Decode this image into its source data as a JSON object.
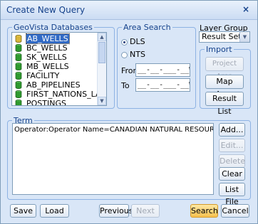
{
  "window": {
    "title": "Create New Query",
    "close_label": "×"
  },
  "databases": {
    "legend": "GeoVista Databases",
    "items": [
      {
        "label": "AB_WELLS",
        "selected": true
      },
      {
        "label": "BC_WELLS",
        "selected": false
      },
      {
        "label": "SK_WELLS",
        "selected": false
      },
      {
        "label": "MB_WELLS",
        "selected": false
      },
      {
        "label": "FACILITY",
        "selected": false
      },
      {
        "label": "AB_PIPELINES",
        "selected": false
      },
      {
        "label": "FIRST_NATIONS_LAND",
        "selected": false
      },
      {
        "label": "POSTINGS",
        "selected": false
      }
    ]
  },
  "area_search": {
    "legend": "Area Search",
    "options": [
      {
        "label": "DLS",
        "checked": true
      },
      {
        "label": "NTS",
        "checked": false
      }
    ],
    "from_label": "From",
    "from_value": "__-__-___-__W_",
    "to_label": "To",
    "to_value": "__-__-___-__W_"
  },
  "layer_group": {
    "label": "Layer Group",
    "selected": "Result Sets"
  },
  "import": {
    "legend": "Import",
    "buttons": {
      "project_area": "Project Area",
      "map_area": "Map Area",
      "result_list": "Result List"
    }
  },
  "term": {
    "legend": "Term",
    "entries": [
      "Operator:Operator Name=CANADIAN NATURAL RESOURCES LIMITED"
    ],
    "buttons": {
      "add": "Add...",
      "edit": "Edit...",
      "delete": "Delete",
      "clear_all": "Clear All",
      "list_file": "List File"
    }
  },
  "footer": {
    "save": "Save",
    "load": "Load",
    "previous": "Previous",
    "next": "Next",
    "search": "Search",
    "cancel": "Cancel"
  },
  "colors": {
    "background": "#d9e6f7",
    "border": "#8db2e3",
    "legend_text": "#15428b",
    "selection": "#316ac5",
    "db_icon": "#2f9a2f",
    "search_accent": "#f7c14f"
  },
  "icons": {
    "database": "database-cylinder-icon"
  }
}
